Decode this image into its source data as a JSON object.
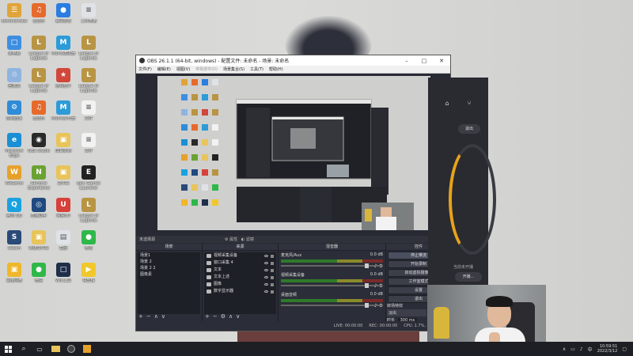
{
  "desktop": {
    "icons": [
      {
        "label": "Administrator",
        "color": "#e0a43a",
        "glyph": "☰"
      },
      {
        "label": "云音乐",
        "color": "#e66a2b",
        "glyph": "♫"
      },
      {
        "label": "暴风影音",
        "color": "#2a7de1",
        "glyph": "●"
      },
      {
        "label": "工作表格",
        "color": "#dfe3e8",
        "glyph": "≡"
      },
      {
        "label": "此电脑",
        "color": "#3d8ee0",
        "glyph": "□"
      },
      {
        "label": "League of Legends",
        "color": "#b89444",
        "glyph": "L"
      },
      {
        "label": "MuMu模拟器",
        "color": "#2c9bd8",
        "glyph": "M"
      },
      {
        "label": "League of Legends",
        "color": "#b89444",
        "glyph": "L"
      },
      {
        "label": "回收站",
        "color": "#8fb4e0",
        "glyph": "♲"
      },
      {
        "label": "League of Legends",
        "color": "#b89444",
        "glyph": "L"
      },
      {
        "label": "游戏盒子",
        "color": "#d1473a",
        "glyph": "★"
      },
      {
        "label": "League of Legends",
        "color": "#b89444",
        "glyph": "L"
      },
      {
        "label": "控制面板",
        "color": "#2f8cd6",
        "glyph": "⚙"
      },
      {
        "label": "云音乐",
        "color": "#e66a2b",
        "glyph": "♫"
      },
      {
        "label": "MuMu多开器",
        "color": "#2c9bd8",
        "glyph": "M"
      },
      {
        "label": "文件",
        "color": "#f2f2f2",
        "glyph": "≡"
      },
      {
        "label": "Microsoft Edge",
        "color": "#1a8fd6",
        "glyph": "e"
      },
      {
        "label": "OBS Studio",
        "color": "#2a2a2a",
        "glyph": "◉"
      },
      {
        "label": "屏幕录制",
        "color": "#e8c45a",
        "glyph": "▣"
      },
      {
        "label": "文件",
        "color": "#f2f2f2",
        "glyph": "≡"
      },
      {
        "label": "WeGame",
        "color": "#e6a12b",
        "glyph": "W"
      },
      {
        "label": "GeForce Experience",
        "color": "#6aa332",
        "glyph": "N"
      },
      {
        "label": "文件夹",
        "color": "#e8c45a",
        "glyph": "▣"
      },
      {
        "label": "Epic Games Launcher",
        "color": "#222222",
        "glyph": "E"
      },
      {
        "label": "腾讯 QQ",
        "color": "#1aa2e0",
        "glyph": "Q"
      },
      {
        "label": "直播助手",
        "color": "#1f4a80",
        "glyph": "◎"
      },
      {
        "label": "网易UU",
        "color": "#d6413a",
        "glyph": "U"
      },
      {
        "label": "League of Legends",
        "color": "#b89444",
        "glyph": "L"
      },
      {
        "label": "Steam",
        "color": "#2a4a78",
        "glyph": "S"
      },
      {
        "label": "新建文件夹",
        "color": "#e8c45a",
        "glyph": "▣"
      },
      {
        "label": "截图",
        "color": "#dfe3e8",
        "glyph": "▤"
      },
      {
        "label": "微信",
        "color": "#2fb84a",
        "glyph": "●"
      },
      {
        "label": "百度网盘",
        "color": "#f0b72b",
        "glyph": "▣"
      },
      {
        "label": "微信",
        "color": "#2fb84a",
        "glyph": "●"
      },
      {
        "label": "Win工具",
        "color": "#1f2f4a",
        "glyph": "□"
      },
      {
        "label": "快剪辑",
        "color": "#f0c82b",
        "glyph": "▶"
      }
    ]
  },
  "obs": {
    "title": "OBS 26.1.1 (64-bit, windows) - 配置文件: 未命名 - 场景: 未命名",
    "menu": [
      "文件(F)",
      "编辑(E)",
      "视图(V)",
      "停靠部件(D)",
      "场景集合(S)",
      "工具(T)",
      "帮助(H)"
    ],
    "no_source": "未选择源",
    "props_label": "属性",
    "filter_label": "滤镜",
    "docks": {
      "scenes_title": "场景",
      "sources_title": "来源",
      "mixer_title": "混音器",
      "controls_title": "控件"
    },
    "scenes": [
      "场景1",
      "场景 2",
      "场景 2 2",
      "图像素"
    ],
    "sources": [
      "视频采集设备",
      "窗口采集 4",
      "文本",
      "文本上述",
      "图像",
      "数字显示器"
    ],
    "mixer": [
      {
        "name": "麦克风/Aux",
        "db": "0.0 dB"
      },
      {
        "name": "视频采集设备",
        "db": "0.0 dB"
      },
      {
        "name": "桌面音频",
        "db": "0.0 dB"
      }
    ],
    "controls": [
      "停止推流",
      "开始录制",
      "启动虚拟摄像机",
      "工作室模式",
      "设置",
      "退出"
    ],
    "transitions_title": "转场特效",
    "transition": "淡出",
    "duration_label": "时长",
    "duration": "300 ms",
    "status": {
      "live": "LIVE: 00:00:00",
      "rec": "REC: 00:00:00",
      "cpu": "CPU: 1.7%, 60.00 fps"
    }
  },
  "app2": {
    "pill_label": "退出",
    "tip": "当前未开播",
    "pill2_label": "开播..."
  },
  "taskbar": {
    "time": "10:59:51",
    "date": "2022/3/12",
    "lang": "中"
  },
  "colors": {
    "obs_bg": "#272a33",
    "taskbar_bg": "#1d1f24",
    "accent": "#e8a31a"
  }
}
